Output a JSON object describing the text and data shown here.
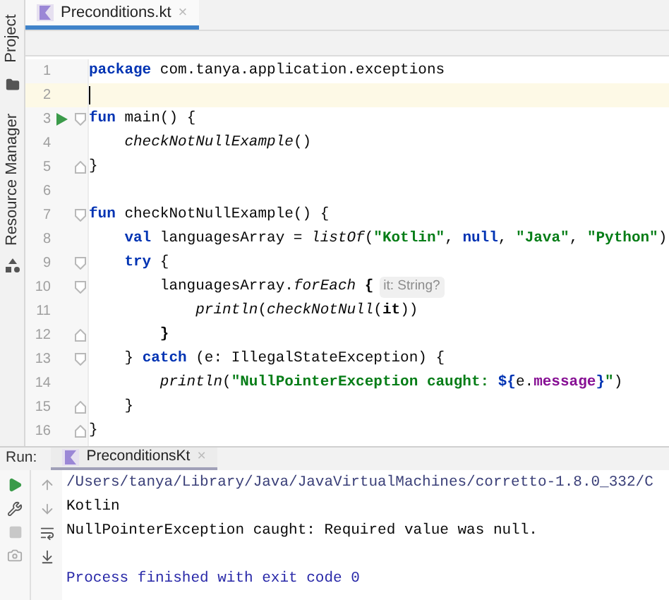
{
  "side_tools": [
    {
      "label": "Project"
    },
    {
      "label": "Resource Manager"
    }
  ],
  "editor_tabs": [
    {
      "label": "Preconditions.kt",
      "close": "×",
      "selected": true
    }
  ],
  "code_lines": [
    {
      "number": "1",
      "run_marker": false,
      "fold_start": false,
      "fold_end": false,
      "current": false,
      "tokens": [
        {
          "kind": "keyword",
          "text": "package"
        },
        {
          "kind": "plain",
          "text": " com.tanya.application.exceptions"
        }
      ]
    },
    {
      "number": "2",
      "run_marker": false,
      "fold_start": false,
      "fold_end": false,
      "current": true
    },
    {
      "number": "3",
      "run_marker": true,
      "fold_start": true,
      "fold_end": false,
      "current": false,
      "tokens": [
        {
          "kind": "keyword",
          "text": "fun"
        },
        {
          "kind": "plain",
          "text": " main() {"
        }
      ]
    },
    {
      "number": "4",
      "run_marker": false,
      "fold_start": false,
      "fold_end": false,
      "current": false,
      "tokens": [
        {
          "kind": "call",
          "text": "    checkNotNullExample"
        },
        {
          "kind": "plain",
          "text": "()"
        }
      ]
    },
    {
      "number": "5",
      "run_marker": false,
      "fold_start": false,
      "fold_end": true,
      "current": false,
      "tokens": [
        {
          "kind": "plain",
          "text": "}"
        }
      ]
    },
    {
      "number": "6",
      "run_marker": false,
      "fold_start": false,
      "fold_end": false,
      "current": false
    },
    {
      "number": "7",
      "run_marker": false,
      "fold_start": true,
      "fold_end": false,
      "current": false,
      "tokens": [
        {
          "kind": "keyword",
          "text": "fun"
        },
        {
          "kind": "plain",
          "text": " checkNotNullExample() {"
        }
      ]
    },
    {
      "number": "8",
      "run_marker": false,
      "fold_start": false,
      "fold_end": false,
      "current": false,
      "tokens": [
        {
          "kind": "keyword",
          "text": "    val"
        },
        {
          "kind": "plain",
          "text": " languagesArray = "
        },
        {
          "kind": "call",
          "text": "listOf"
        },
        {
          "kind": "plain",
          "text": "("
        },
        {
          "kind": "string",
          "text": "\"Kotlin\""
        },
        {
          "kind": "plain",
          "text": ", "
        },
        {
          "kind": "keyword",
          "text": "null"
        },
        {
          "kind": "plain",
          "text": ", "
        },
        {
          "kind": "string",
          "text": "\"Java\""
        },
        {
          "kind": "plain",
          "text": ", "
        },
        {
          "kind": "string",
          "text": "\"Python\""
        },
        {
          "kind": "plain",
          "text": ")"
        }
      ]
    },
    {
      "number": "9",
      "run_marker": false,
      "fold_start": true,
      "fold_end": false,
      "current": false,
      "tokens": [
        {
          "kind": "keyword",
          "text": "    try"
        },
        {
          "kind": "plain",
          "text": " {"
        }
      ]
    },
    {
      "number": "10",
      "run_marker": false,
      "fold_start": true,
      "fold_end": false,
      "current": false,
      "tokens": [
        {
          "kind": "plain",
          "text": "        languagesArray."
        },
        {
          "kind": "call",
          "text": "forEach"
        },
        {
          "kind": "bold",
          "text": " {"
        },
        {
          "kind": "hint",
          "text": "it: String?"
        }
      ]
    },
    {
      "number": "11",
      "run_marker": false,
      "fold_start": false,
      "fold_end": false,
      "current": false,
      "tokens": [
        {
          "kind": "call",
          "text": "            println"
        },
        {
          "kind": "plain",
          "text": "("
        },
        {
          "kind": "call",
          "text": "checkNotNull"
        },
        {
          "kind": "plain",
          "text": "("
        },
        {
          "kind": "bold",
          "text": "it"
        },
        {
          "kind": "plain",
          "text": "))"
        }
      ]
    },
    {
      "number": "12",
      "run_marker": false,
      "fold_start": false,
      "fold_end": true,
      "current": false,
      "tokens": [
        {
          "kind": "bold",
          "text": "        }"
        }
      ]
    },
    {
      "number": "13",
      "run_marker": false,
      "fold_start": true,
      "fold_end": false,
      "current": false,
      "tokens": [
        {
          "kind": "plain",
          "text": "    } "
        },
        {
          "kind": "keyword",
          "text": "catch"
        },
        {
          "kind": "plain",
          "text": " (e: IllegalStateException) {"
        }
      ]
    },
    {
      "number": "14",
      "run_marker": false,
      "fold_start": false,
      "fold_end": false,
      "current": false,
      "tokens": [
        {
          "kind": "call",
          "text": "        println"
        },
        {
          "kind": "plain",
          "text": "("
        },
        {
          "kind": "string",
          "text": "\"NullPointerException caught: "
        },
        {
          "kind": "keyword",
          "text": "${"
        },
        {
          "kind": "plain",
          "text": "e."
        },
        {
          "kind": "member",
          "text": "message"
        },
        {
          "kind": "keyword",
          "text": "}"
        },
        {
          "kind": "string",
          "text": "\""
        },
        {
          "kind": "plain",
          "text": ")"
        }
      ]
    },
    {
      "number": "15",
      "run_marker": false,
      "fold_start": false,
      "fold_end": true,
      "current": false,
      "tokens": [
        {
          "kind": "plain",
          "text": "    }"
        }
      ]
    },
    {
      "number": "16",
      "run_marker": false,
      "fold_start": false,
      "fold_end": true,
      "current": false,
      "tokens": [
        {
          "kind": "plain",
          "text": "}"
        }
      ]
    }
  ],
  "run_panel": {
    "label": "Run:",
    "tabs": [
      {
        "label": "PreconditionsKt",
        "close": "×",
        "selected": true
      }
    ],
    "console": [
      {
        "kind": "command",
        "text": "/Users/tanya/Library/Java/JavaVirtualMachines/corretto-1.8.0_332/C"
      },
      {
        "kind": "output",
        "text": "Kotlin"
      },
      {
        "kind": "output",
        "text": "NullPointerException caught: Required value was null."
      },
      {
        "kind": "exit",
        "text": "Process finished with exit code 0"
      }
    ]
  }
}
